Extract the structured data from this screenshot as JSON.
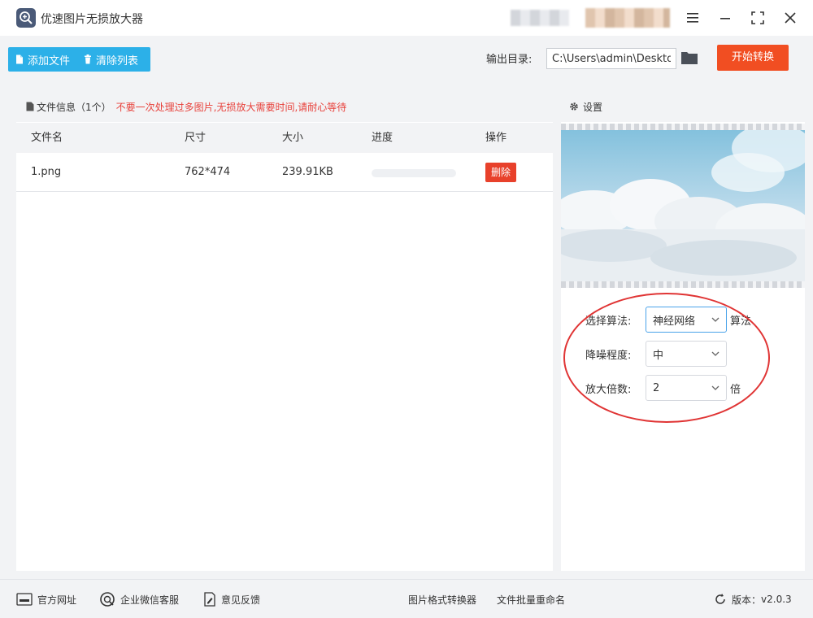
{
  "app": {
    "title": "优速图片无损放大器"
  },
  "toolbar": {
    "add_file": "添加文件",
    "clear_list": "清除列表",
    "output_label": "输出目录:",
    "output_path": "C:\\Users\\admin\\Desktop",
    "start": "开始转换"
  },
  "file_panel": {
    "header_title": "文件信息（1个）",
    "warning": "不要一次处理过多图片,无损放大需要时间,请耐心等待",
    "columns": [
      "文件名",
      "尺寸",
      "大小",
      "进度",
      "操作"
    ],
    "rows": [
      {
        "name": "1.png",
        "size": "762*474",
        "filesize": "239.91KB",
        "progress": 0,
        "action": "删除"
      }
    ]
  },
  "settings": {
    "title": "设置",
    "algorithm": {
      "label": "选择算法:",
      "value": "神经网络",
      "suffix": "算法"
    },
    "denoise": {
      "label": "降噪程度:",
      "value": "中"
    },
    "scale": {
      "label": "放大倍数:",
      "value": "2",
      "suffix": "倍"
    }
  },
  "footer": {
    "website": "官方网址",
    "wechat": "企业微信客服",
    "feedback": "意见反馈",
    "format_converter": "图片格式转换器",
    "batch_rename": "文件批量重命名",
    "version_label": "版本：",
    "version": "v2.0.3"
  },
  "icons": {
    "logo": "magnifier-plus-icon",
    "add": "document-icon",
    "clear": "trash-icon",
    "folder": "folder-icon",
    "settings": "gear-icon"
  },
  "colors": {
    "accent_blue": "#2cb0e8",
    "start_red": "#f14e22",
    "warning_red": "#e8413b",
    "highlight_ellipse": "#e03434"
  }
}
